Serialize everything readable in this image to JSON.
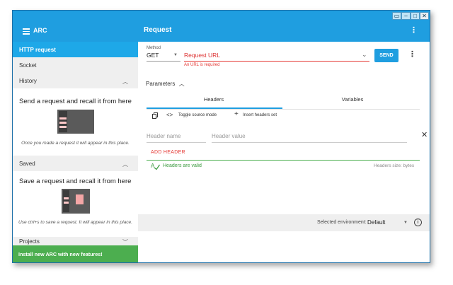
{
  "window": {
    "controls": [
      "▭",
      "–",
      "□",
      "✕"
    ]
  },
  "appbar": {
    "app_name": "ARC",
    "title": "Request"
  },
  "sidebar": {
    "http_request": "HTTP request",
    "socket": "Socket",
    "history": {
      "label": "History",
      "empty_title": "Send a request and recall it from here",
      "empty_text": "Once you made a request it will appear in this place."
    },
    "saved": {
      "label": "Saved",
      "empty_title": "Save a request and recall it from here",
      "empty_text": "Use ctrl+s to save a request. It will appear in this place."
    },
    "projects": "Projects",
    "install_banner": "Install new ARC with new features!"
  },
  "request": {
    "method_label": "Method",
    "method_value": "GET",
    "url_placeholder": "Request URL",
    "url_error": "An URL is required",
    "send_label": "SEND",
    "parameters_label": "Parameters",
    "tabs": [
      "Headers",
      "Variables"
    ],
    "toggle_source": "Toggle source mode",
    "insert_headers": "Insert headers set",
    "header_name_placeholder": "Header name",
    "header_value_placeholder": "Header value",
    "add_header": "ADD HEADER",
    "headers_valid": "Headers are valid",
    "headers_size": "Headers size: bytes"
  },
  "footer": {
    "env_label": "Selected environment:",
    "env_value": "Default"
  },
  "colors": {
    "primary": "#1f9ee0",
    "active_item": "#1ea8e8",
    "error": "#e53935",
    "success": "#4caf50",
    "install_banner": "#4cae4f"
  }
}
